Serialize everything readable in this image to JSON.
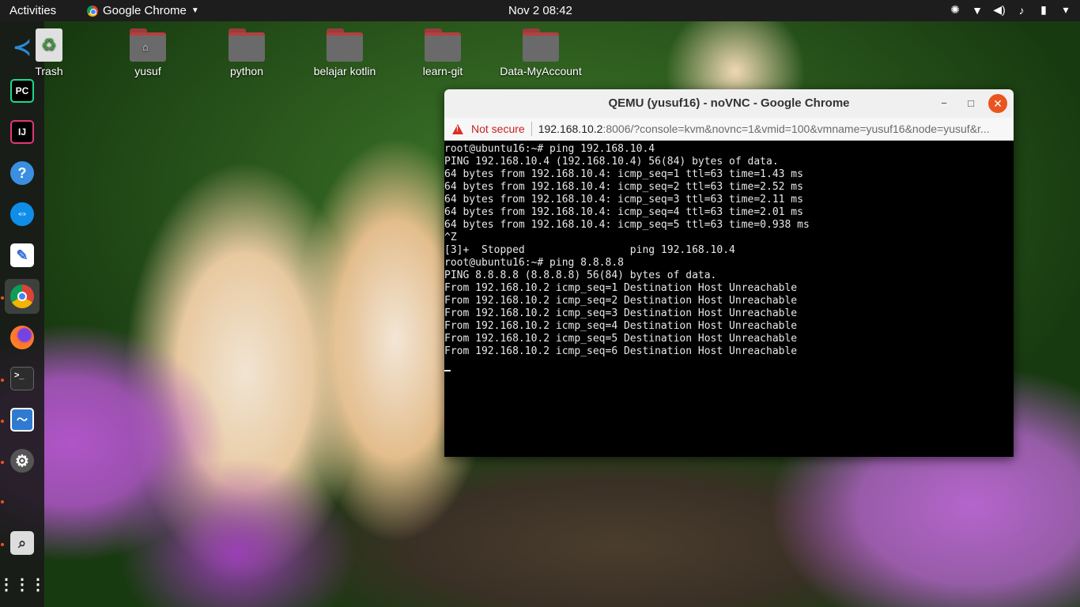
{
  "topbar": {
    "activities": "Activities",
    "app_name": "Google Chrome",
    "clock": "Nov 2  08:42"
  },
  "dock": {
    "items": [
      {
        "name": "vscode-icon",
        "label": "VS Code",
        "color": "#2a8ad4"
      },
      {
        "name": "pycharm-icon",
        "label": "PC",
        "color": "#21d789"
      },
      {
        "name": "intellij-icon",
        "label": "IJ",
        "color": "#e2367a"
      },
      {
        "name": "help-icon",
        "label": "?",
        "color": "#3a8fe0"
      },
      {
        "name": "teamviewer-icon",
        "label": "TV",
        "color": "#0e8ee9"
      },
      {
        "name": "text-editor-icon",
        "label": "Text Editor",
        "color": "#ffffff"
      },
      {
        "name": "chrome-icon",
        "label": "Chrome",
        "color": "#4285f4"
      },
      {
        "name": "firefox-icon",
        "label": "Firefox",
        "color": "#ff7139"
      },
      {
        "name": "terminal-icon",
        "label": ">_",
        "color": "#333333"
      },
      {
        "name": "system-monitor-icon",
        "label": "Monitor",
        "color": "#2f7bd1"
      },
      {
        "name": "settings-icon",
        "label": "Settings",
        "color": "#777777"
      },
      {
        "name": "screenshot-icon",
        "label": "Screenshot",
        "color": "#dddddd"
      },
      {
        "name": "show-apps-icon",
        "label": "Show Applications",
        "color": "#ffffff"
      }
    ]
  },
  "desktop": {
    "icons": [
      {
        "label": "Trash"
      },
      {
        "label": "yusuf"
      },
      {
        "label": "python"
      },
      {
        "label": "belajar kotlin"
      },
      {
        "label": "learn-git"
      },
      {
        "label": "Data-MyAccount"
      }
    ]
  },
  "window": {
    "title": "QEMU (yusuf16) - noVNC - Google Chrome",
    "minimize": "−",
    "maximize": "□",
    "close": "✕",
    "not_secure": "Not secure",
    "url_host": "192.168.10.2",
    "url_rest": ":8006/?console=kvm&novnc=1&vmid=100&vmname=yusuf16&node=yusuf&r..."
  },
  "terminal": {
    "lines": [
      "root@ubuntu16:~# ping 192.168.10.4",
      "PING 192.168.10.4 (192.168.10.4) 56(84) bytes of data.",
      "64 bytes from 192.168.10.4: icmp_seq=1 ttl=63 time=1.43 ms",
      "64 bytes from 192.168.10.4: icmp_seq=2 ttl=63 time=2.52 ms",
      "64 bytes from 192.168.10.4: icmp_seq=3 ttl=63 time=2.11 ms",
      "64 bytes from 192.168.10.4: icmp_seq=4 ttl=63 time=2.01 ms",
      "64 bytes from 192.168.10.4: icmp_seq=5 ttl=63 time=0.938 ms",
      "^Z",
      "[3]+  Stopped                 ping 192.168.10.4",
      "root@ubuntu16:~# ping 8.8.8.8",
      "PING 8.8.8.8 (8.8.8.8) 56(84) bytes of data.",
      "From 192.168.10.2 icmp_seq=1 Destination Host Unreachable",
      "From 192.168.10.2 icmp_seq=2 Destination Host Unreachable",
      "From 192.168.10.2 icmp_seq=3 Destination Host Unreachable",
      "From 192.168.10.2 icmp_seq=4 Destination Host Unreachable",
      "From 192.168.10.2 icmp_seq=5 Destination Host Unreachable",
      "From 192.168.10.2 icmp_seq=6 Destination Host Unreachable"
    ]
  }
}
